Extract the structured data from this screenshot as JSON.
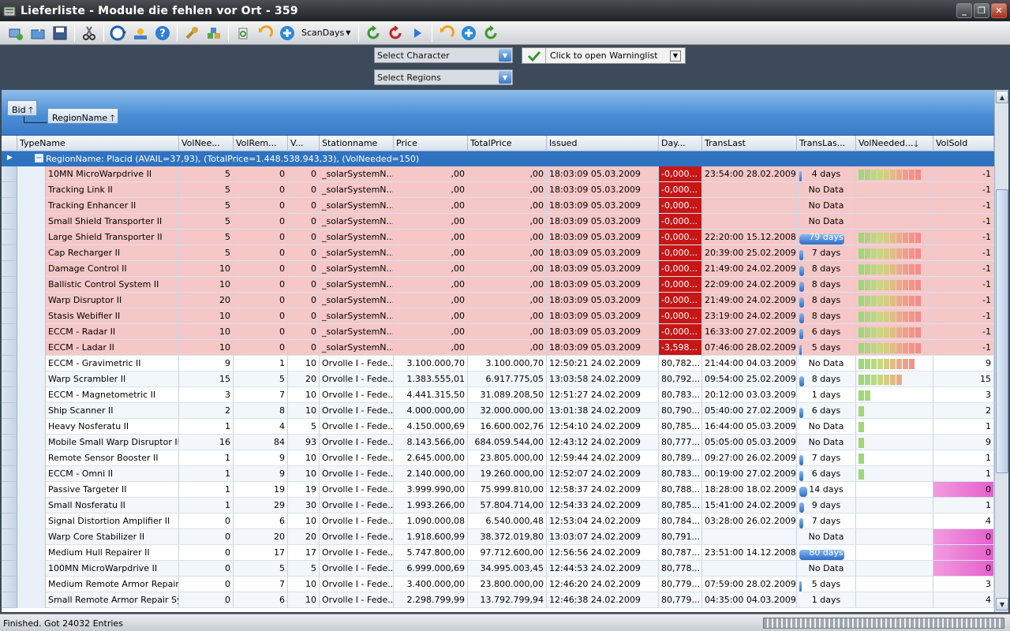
{
  "window": {
    "title": "Lieferliste - Module die fehlen vor Ort - 359"
  },
  "toolbar": {
    "icons": [
      "add-icon",
      "open-icon",
      "save-icon",
      "cut-icon",
      "globe-icon",
      "weather-icon",
      "help-icon",
      "wrench-icon",
      "cubes-icon",
      "recycle-icon",
      "refresh-icon",
      "plus-icon",
      "reload-icon",
      "stop-icon",
      "play-icon",
      "refresh-icon",
      "plus-icon",
      "reload-icon"
    ],
    "scan_days_label": "ScanDays"
  },
  "filters": {
    "character_placeholder": "Select Character",
    "regions_placeholder": "Select Regions",
    "warninglist_label": "Click to open Warninglist"
  },
  "grid": {
    "group_chips": [
      "Bid",
      "RegionName"
    ],
    "columns": [
      "TypeName",
      "VolNee...",
      "VolRem...",
      "V...",
      "Stationname",
      "Price",
      "TotalPrice",
      "Issued",
      "Day...",
      "TransLast",
      "TransLas...",
      "VolNeeded...",
      "VolSold"
    ],
    "group_row": "RegionName: Placid (AVAIL=37,93), (TotalPrice=1.448.538.943,33), (VolNeeded=150)",
    "rows": [
      {
        "name": "10MN MicroWarpdrive II",
        "vn": "5",
        "vr": "0",
        "v": "0",
        "st": "_solarSystemN...",
        "price": ",00",
        "total": ",00",
        "issued": "18:03:09 05.03.2009",
        "day": "-0,000...",
        "tlast": "23:54:00 28.02.2009",
        "tl": "4 days",
        "bar": 0.05,
        "vol": 10,
        "sold": "-1",
        "pink": true
      },
      {
        "name": "Tracking Link II",
        "vn": "5",
        "vr": "0",
        "v": "0",
        "st": "_solarSystemN...",
        "price": ",00",
        "total": ",00",
        "issued": "18:03:09 05.03.2009",
        "day": "-0,000...",
        "tlast": "",
        "tl": "No Data",
        "bar": 0,
        "vol": 0,
        "sold": "-1",
        "pink": true
      },
      {
        "name": "Tracking Enhancer II",
        "vn": "5",
        "vr": "0",
        "v": "0",
        "st": "_solarSystemN...",
        "price": ",00",
        "total": ",00",
        "issued": "18:03:09 05.03.2009",
        "day": "-0,000...",
        "tlast": "",
        "tl": "No Data",
        "bar": 0,
        "vol": 0,
        "sold": "-1",
        "pink": true
      },
      {
        "name": "Small Shield Transporter II",
        "vn": "5",
        "vr": "0",
        "v": "0",
        "st": "_solarSystemN...",
        "price": ",00",
        "total": ",00",
        "issued": "18:03:09 05.03.2009",
        "day": "-0,000...",
        "tlast": "",
        "tl": "No Data",
        "bar": 0,
        "vol": 0,
        "sold": "-1",
        "pink": true
      },
      {
        "name": "Large Shield Transporter II",
        "vn": "5",
        "vr": "0",
        "v": "0",
        "st": "_solarSystemN...",
        "price": ",00",
        "total": ",00",
        "issued": "18:03:09 05.03.2009",
        "day": "-0,000...",
        "tlast": "22:20:00 15.12.2008",
        "tl": "79 days",
        "bar": 0.98,
        "vol": 10,
        "sold": "-1",
        "pink": true
      },
      {
        "name": "Cap Recharger II",
        "vn": "5",
        "vr": "0",
        "v": "0",
        "st": "_solarSystemN...",
        "price": ",00",
        "total": ",00",
        "issued": "18:03:09 05.03.2009",
        "day": "-0,000...",
        "tlast": "20:39:00 25.02.2009",
        "tl": "7 days",
        "bar": 0.09,
        "vol": 10,
        "sold": "-1",
        "pink": true
      },
      {
        "name": "Damage Control II",
        "vn": "10",
        "vr": "0",
        "v": "0",
        "st": "_solarSystemN...",
        "price": ",00",
        "total": ",00",
        "issued": "18:03:09 05.03.2009",
        "day": "-0,000...",
        "tlast": "21:49:00 24.02.2009",
        "tl": "8 days",
        "bar": 0.1,
        "vol": 10,
        "sold": "-1",
        "pink": true
      },
      {
        "name": "Ballistic Control System II",
        "vn": "10",
        "vr": "0",
        "v": "0",
        "st": "_solarSystemN...",
        "price": ",00",
        "total": ",00",
        "issued": "18:03:09 05.03.2009",
        "day": "-0,000...",
        "tlast": "22:09:00 24.02.2009",
        "tl": "8 days",
        "bar": 0.1,
        "vol": 10,
        "sold": "-1",
        "pink": true
      },
      {
        "name": "Warp Disruptor II",
        "vn": "20",
        "vr": "0",
        "v": "0",
        "st": "_solarSystemN...",
        "price": ",00",
        "total": ",00",
        "issued": "18:03:09 05.03.2009",
        "day": "-0,000...",
        "tlast": "21:49:00 24.02.2009",
        "tl": "8 days",
        "bar": 0.1,
        "vol": 10,
        "sold": "-1",
        "pink": true
      },
      {
        "name": "Stasis Webifier II",
        "vn": "10",
        "vr": "0",
        "v": "0",
        "st": "_solarSystemN...",
        "price": ",00",
        "total": ",00",
        "issued": "18:03:09 05.03.2009",
        "day": "-0,000...",
        "tlast": "23:19:00 24.02.2009",
        "tl": "8 days",
        "bar": 0.1,
        "vol": 10,
        "sold": "-1",
        "pink": true
      },
      {
        "name": "ECCM - Radar II",
        "vn": "10",
        "vr": "0",
        "v": "0",
        "st": "_solarSystemN...",
        "price": ",00",
        "total": ",00",
        "issued": "18:03:09 05.03.2009",
        "day": "-0,000...",
        "tlast": "16:33:00 27.02.2009",
        "tl": "6 days",
        "bar": 0.08,
        "vol": 10,
        "sold": "-1",
        "pink": true
      },
      {
        "name": "ECCM - Ladar II",
        "vn": "10",
        "vr": "0",
        "v": "0",
        "st": "_solarSystemN...",
        "price": ",00",
        "total": ",00",
        "issued": "18:03:09 05.03.2009",
        "day": "-3,598...",
        "tlast": "07:46:00 28.02.2009",
        "tl": "5 days",
        "bar": 0.06,
        "vol": 10,
        "sold": "-1",
        "pink": true
      },
      {
        "name": "ECCM - Gravimetric II",
        "vn": "9",
        "vr": "1",
        "v": "10",
        "st": "Orvolle I - Fede...",
        "price": "3.100.000,70",
        "total": "3.100.000,70",
        "issued": "12:50:21 24.02.2009",
        "day": "80,782...",
        "tlast": "21:44:00 04.03.2009",
        "tl": "No Data",
        "bar": 0,
        "vol": 9,
        "sold": "9",
        "pink": false
      },
      {
        "name": "Warp Scrambler II",
        "vn": "15",
        "vr": "5",
        "v": "20",
        "st": "Orvolle I - Fede...",
        "price": "1.383.555,01",
        "total": "6.917.775,05",
        "issued": "13:03:58 24.02.2009",
        "day": "80,792...",
        "tlast": "09:54:00 25.02.2009",
        "tl": "8 days",
        "bar": 0.1,
        "vol": 7,
        "sold": "15",
        "pink": false
      },
      {
        "name": "ECCM - Magnetometric II",
        "vn": "3",
        "vr": "7",
        "v": "10",
        "st": "Orvolle I - Fede...",
        "price": "4.441.315,50",
        "total": "31.089.208,50",
        "issued": "12:51:27 24.02.2009",
        "day": "80,783...",
        "tlast": "20:12:00 03.03.2009",
        "tl": "1 days",
        "bar": 0,
        "vol": 2,
        "sold": "3",
        "pink": false
      },
      {
        "name": "Ship Scanner II",
        "vn": "2",
        "vr": "8",
        "v": "10",
        "st": "Orvolle I - Fede...",
        "price": "4.000.000,00",
        "total": "32.000.000,00",
        "issued": "13:01:38 24.02.2009",
        "day": "80,790...",
        "tlast": "05:40:00 27.02.2009",
        "tl": "6 days",
        "bar": 0.08,
        "vol": 1,
        "sold": "2",
        "pink": false
      },
      {
        "name": "Heavy Nosferatu II",
        "vn": "1",
        "vr": "4",
        "v": "5",
        "st": "Orvolle I - Fede...",
        "price": "4.150.000,69",
        "total": "16.600.002,76",
        "issued": "12:54:10 24.02.2009",
        "day": "80,785...",
        "tlast": "16:44:00 05.03.2009",
        "tl": "No Data",
        "bar": 0,
        "vol": 1,
        "sold": "1",
        "pink": false
      },
      {
        "name": "Mobile Small Warp Disruptor II",
        "vn": "16",
        "vr": "84",
        "v": "93",
        "st": "Orvolle I - Fede...",
        "price": "8.143.566,00",
        "total": "684.059.544,00",
        "issued": "12:43:12 24.02.2009",
        "day": "80,777...",
        "tlast": "05:05:00 05.03.2009",
        "tl": "No Data",
        "bar": 0,
        "vol": 1,
        "sold": "9",
        "pink": false
      },
      {
        "name": "Remote Sensor Booster II",
        "vn": "1",
        "vr": "9",
        "v": "10",
        "st": "Orvolle I - Fede...",
        "price": "2.645.000,00",
        "total": "23.805.000,00",
        "issued": "12:59:44 24.02.2009",
        "day": "80,789...",
        "tlast": "09:27:00 26.02.2009",
        "tl": "7 days",
        "bar": 0.09,
        "vol": 1,
        "sold": "1",
        "pink": false
      },
      {
        "name": "ECCM - Omni II",
        "vn": "1",
        "vr": "9",
        "v": "10",
        "st": "Orvolle I - Fede...",
        "price": "2.140.000,00",
        "total": "19.260.000,00",
        "issued": "12:52:07 24.02.2009",
        "day": "80,783...",
        "tlast": "00:19:00 27.02.2009",
        "tl": "6 days",
        "bar": 0.08,
        "vol": 1,
        "sold": "1",
        "pink": false
      },
      {
        "name": "Passive Targeter II",
        "vn": "1",
        "vr": "19",
        "v": "19",
        "st": "Orvolle I - Fede...",
        "price": "3.999.990,00",
        "total": "75.999.810,00",
        "issued": "12:58:37 24.02.2009",
        "day": "80,788...",
        "tlast": "18:28:00 18.02.2009",
        "tl": "14 days",
        "bar": 0.18,
        "vol": 0,
        "sold": "0",
        "pink": false,
        "magenta": true
      },
      {
        "name": "Small Nosferatu II",
        "vn": "1",
        "vr": "29",
        "v": "30",
        "st": "Orvolle I - Fede...",
        "price": "1.993.266,00",
        "total": "57.804.714,00",
        "issued": "12:54:33 24.02.2009",
        "day": "80,785...",
        "tlast": "15:41:00 24.02.2009",
        "tl": "9 days",
        "bar": 0.11,
        "vol": 0,
        "sold": "1",
        "pink": false
      },
      {
        "name": "Signal Distortion Amplifier II",
        "vn": "0",
        "vr": "6",
        "v": "10",
        "st": "Orvolle I - Fede...",
        "price": "1.090.000,08",
        "total": "6.540.000,48",
        "issued": "12:53:04 24.02.2009",
        "day": "80,784...",
        "tlast": "03:28:00 26.02.2009",
        "tl": "7 days",
        "bar": 0.09,
        "vol": 0,
        "sold": "4",
        "pink": false
      },
      {
        "name": "Warp Core Stabilizer II",
        "vn": "0",
        "vr": "20",
        "v": "20",
        "st": "Orvolle I - Fede...",
        "price": "1.918.600,99",
        "total": "38.372.019,80",
        "issued": "13:03:07 24.02.2009",
        "day": "80,791...",
        "tlast": "",
        "tl": "No Data",
        "bar": 0,
        "vol": 0,
        "sold": "0",
        "pink": false,
        "magenta": true
      },
      {
        "name": "Medium Hull Repairer II",
        "vn": "0",
        "vr": "17",
        "v": "17",
        "st": "Orvolle I - Fede...",
        "price": "5.747.800,00",
        "total": "97.712.600,00",
        "issued": "12:56:56 24.02.2009",
        "day": "80,787...",
        "tlast": "23:51:00 14.12.2008",
        "tl": "80 days",
        "bar": 0.99,
        "vol": 0,
        "sold": "0",
        "pink": false,
        "magenta": true
      },
      {
        "name": "100MN MicroWarpdrive II",
        "vn": "0",
        "vr": "5",
        "v": "5",
        "st": "Orvolle I - Fede...",
        "price": "6.999.000,69",
        "total": "34.995.003,45",
        "issued": "12:44:53 24.02.2009",
        "day": "80,778...",
        "tlast": "",
        "tl": "No Data",
        "bar": 0,
        "vol": 0,
        "sold": "0",
        "pink": false,
        "magenta": true
      },
      {
        "name": "Medium Remote Armor Repair S...",
        "vn": "0",
        "vr": "7",
        "v": "10",
        "st": "Orvolle I - Fede...",
        "price": "3.400.000,00",
        "total": "23.800.000,00",
        "issued": "12:46:20 24.02.2009",
        "day": "80,779...",
        "tlast": "07:59:00 28.02.2009",
        "tl": "5 days",
        "bar": 0.06,
        "vol": 0,
        "sold": "3",
        "pink": false
      },
      {
        "name": "Small Remote Armor Repair Sys...",
        "vn": "0",
        "vr": "6",
        "v": "10",
        "st": "Orvolle I - Fede...",
        "price": "2.298.799,99",
        "total": "13.792.799,94",
        "issued": "12:46:38 24.02.2009",
        "day": "80,779...",
        "tlast": "04:35:00 04.03.2009",
        "tl": "1 days",
        "bar": 0,
        "vol": 0,
        "sold": "4",
        "pink": false
      }
    ]
  },
  "colors": {
    "pink_row": "#f6c7c7",
    "red_day": "#c61616",
    "group_row": "#2f73c0",
    "magenta_sold": "#e45fcc",
    "trans_bar": "#2e6cc4"
  },
  "status": {
    "text": "Finished. Got 24032 Entries"
  }
}
